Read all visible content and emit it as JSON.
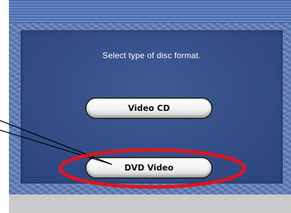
{
  "dialog": {
    "prompt": "Select type of disc format.",
    "options": [
      {
        "label": "Video CD"
      },
      {
        "label": "DVD Video"
      }
    ]
  },
  "annotation": {
    "highlight_color": "#e0141e",
    "pointer_color": "#000000"
  }
}
